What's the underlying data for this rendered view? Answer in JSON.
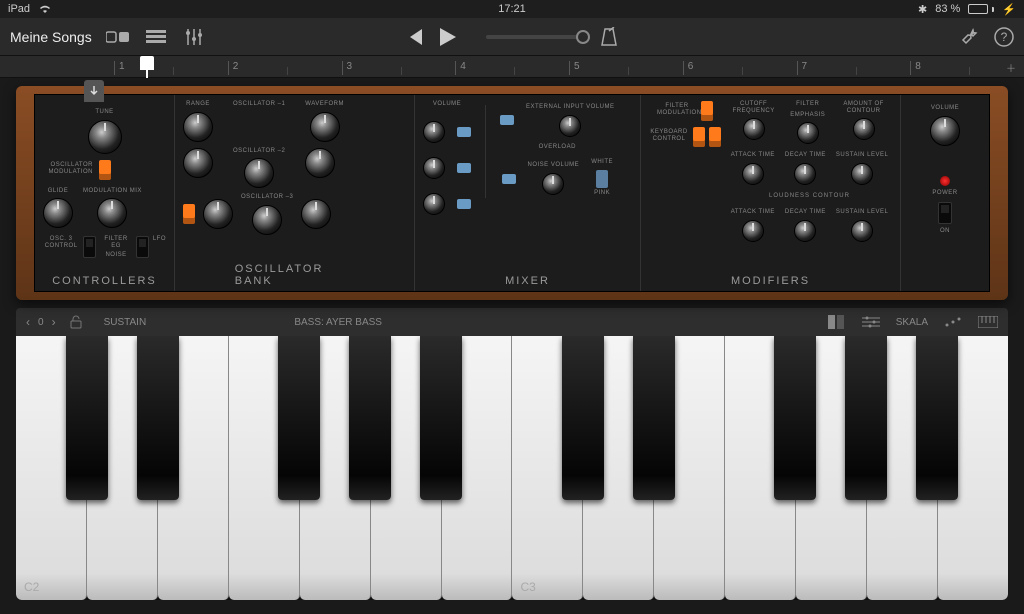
{
  "status": {
    "device": "iPad",
    "time": "17:21",
    "battery_pct": "83 %"
  },
  "toolbar": {
    "songs_label": "Meine Songs"
  },
  "ruler": {
    "bars": [
      "1",
      "2",
      "3",
      "4",
      "5",
      "6",
      "7",
      "8"
    ]
  },
  "synth": {
    "sections": {
      "controllers": "CONTROLLERS",
      "oscillator": "OSCILLATOR  BANK",
      "mixer": "MIXER",
      "modifiers": "MODIFIERS"
    },
    "labels": {
      "tune": "TUNE",
      "glide": "GLIDE",
      "modmix": "MODULATION MIX",
      "oscmod": "OSCILLATOR MODULATION",
      "osc3ctrl": "OSC. 3 CONTROL",
      "filtereg": "FILTER EG",
      "noise": "NOISE",
      "lfo": "LFO",
      "range": "RANGE",
      "osc1": "OSCILLATOR –1",
      "osc2": "OSCILLATOR –2",
      "osc3": "OSCILLATOR –3",
      "freq": "FREQUENCY",
      "waveform": "WAVEFORM",
      "volume": "VOLUME",
      "extinput": "EXTERNAL INPUT VOLUME",
      "overload": "OVERLOAD",
      "noisevol": "NOISE VOLUME",
      "white": "WHITE",
      "pink": "PINK",
      "filtermod": "FILTER MODULATION",
      "kbdctrl": "KEYBOARD CONTROL",
      "cutoff": "CUTOFF FREQUENCY",
      "filter": "FILTER",
      "emphasis": "EMPHASIS",
      "amtcontour": "AMOUNT OF CONTOUR",
      "attack": "ATTACK TIME",
      "decay": "DECAY TIME",
      "sustain": "SUSTAIN LEVEL",
      "loudness": "LOUDNESS CONTOUR",
      "power": "POWER",
      "on": "ON"
    }
  },
  "kbar": {
    "octave": "0",
    "sustain": "SUSTAIN",
    "preset": "BASS: AYER BASS",
    "scale": "SKALA"
  },
  "piano": {
    "c2": "C2",
    "c3": "C3"
  }
}
